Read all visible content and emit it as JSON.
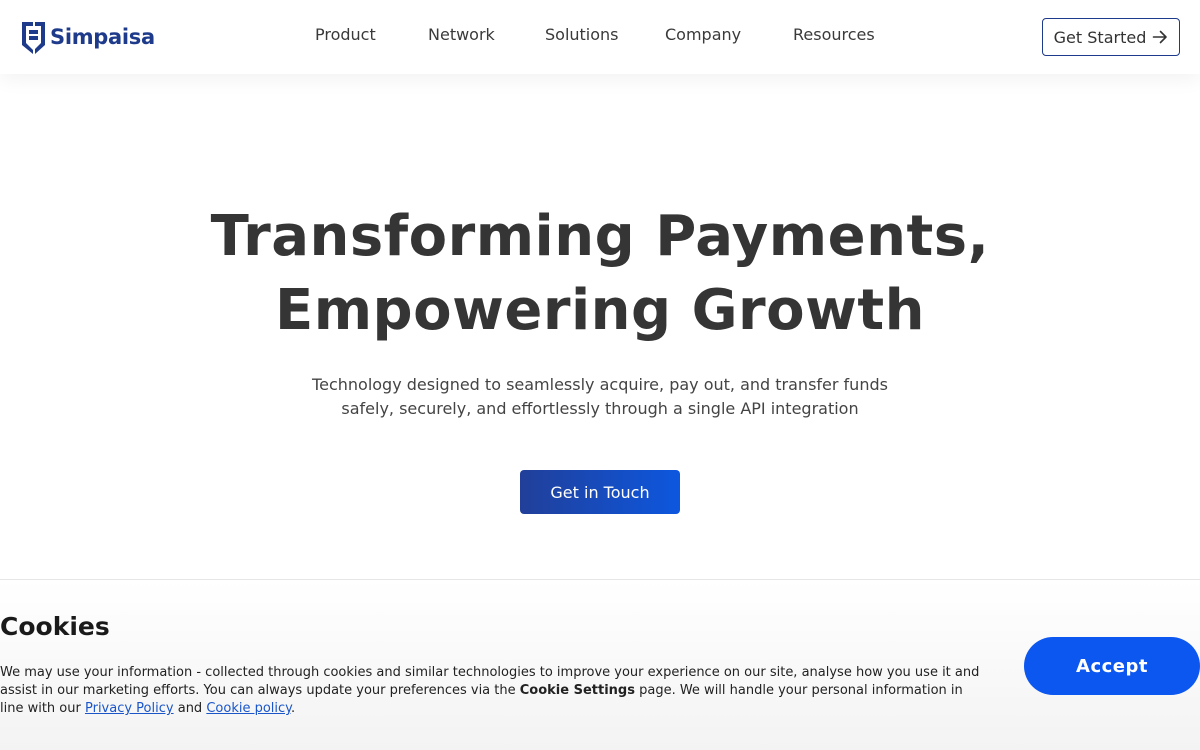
{
  "header": {
    "logo_text": "Simpaisa",
    "nav": [
      {
        "label": "Product"
      },
      {
        "label": "Network"
      },
      {
        "label": "Solutions"
      },
      {
        "label": "Company"
      },
      {
        "label": "Resources"
      }
    ],
    "cta_label": "Get Started",
    "cta_icon": "arrow-right-icon",
    "brand_color": "#1e3a8a"
  },
  "hero": {
    "title_line1": "Transforming Payments,",
    "title_line2": "Empowering Growth",
    "subtitle_line1": "Technology designed to seamlessly acquire, pay out, and transfer funds",
    "subtitle_line2": "safely, securely, and effortlessly through a single API integration",
    "button_label": "Get in Touch"
  },
  "cookie": {
    "title": "Cookies",
    "text_part1": "We may use your information - collected through cookies and similar technologies to improve your experience on our site, analyse how you use it and assist in our marketing efforts. You can always update your preferences via the ",
    "settings_label": "Cookie Settings",
    "text_part2": " page. We will handle your personal information in line with our ",
    "privacy_link": "Privacy Policy",
    "and_text": " and ",
    "cookie_link": "Cookie policy",
    "end_text": ".",
    "accept_label": "Accept",
    "accept_color": "#0b57f0"
  }
}
